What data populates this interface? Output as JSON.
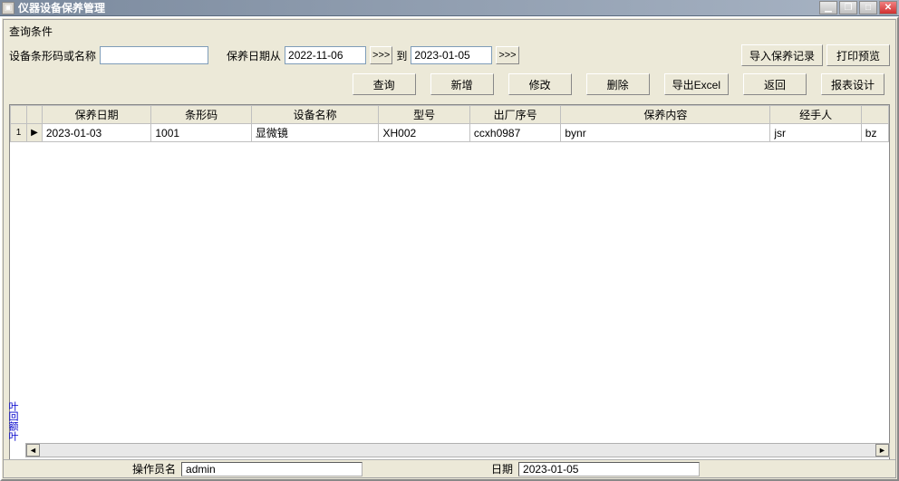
{
  "window": {
    "title": "仪器设备保养管理"
  },
  "query": {
    "section_label": "查询条件",
    "barcode_label": "设备条形码或名称",
    "barcode_value": "",
    "date_from_label": "保养日期从",
    "date_from": "2022-11-06",
    "to_label": "到",
    "date_to": "2023-01-05",
    "picker_btn": ">>>"
  },
  "buttons": {
    "import": "导入保养记录",
    "print_preview": "打印预览",
    "query": "查询",
    "add": "新增",
    "edit": "修改",
    "delete": "删除",
    "export_excel": "导出Excel",
    "back": "返回",
    "report_design": "报表设计"
  },
  "table": {
    "columns": [
      "保养日期",
      "条形码",
      "设备名称",
      "型号",
      "出厂序号",
      "保养内容",
      "经手人",
      ""
    ],
    "rows": [
      {
        "n": "1",
        "date": "2023-01-03",
        "barcode": "1001",
        "name": "显微镜",
        "model": "XH002",
        "serial": "ccxh0987",
        "content": "bynr",
        "handler": "jsr",
        "last": "bz"
      }
    ]
  },
  "side_label": "叶回额叶",
  "status": {
    "operator_label": "操作员名",
    "operator": "admin",
    "date_label": "日期",
    "date": "2023-01-05"
  }
}
